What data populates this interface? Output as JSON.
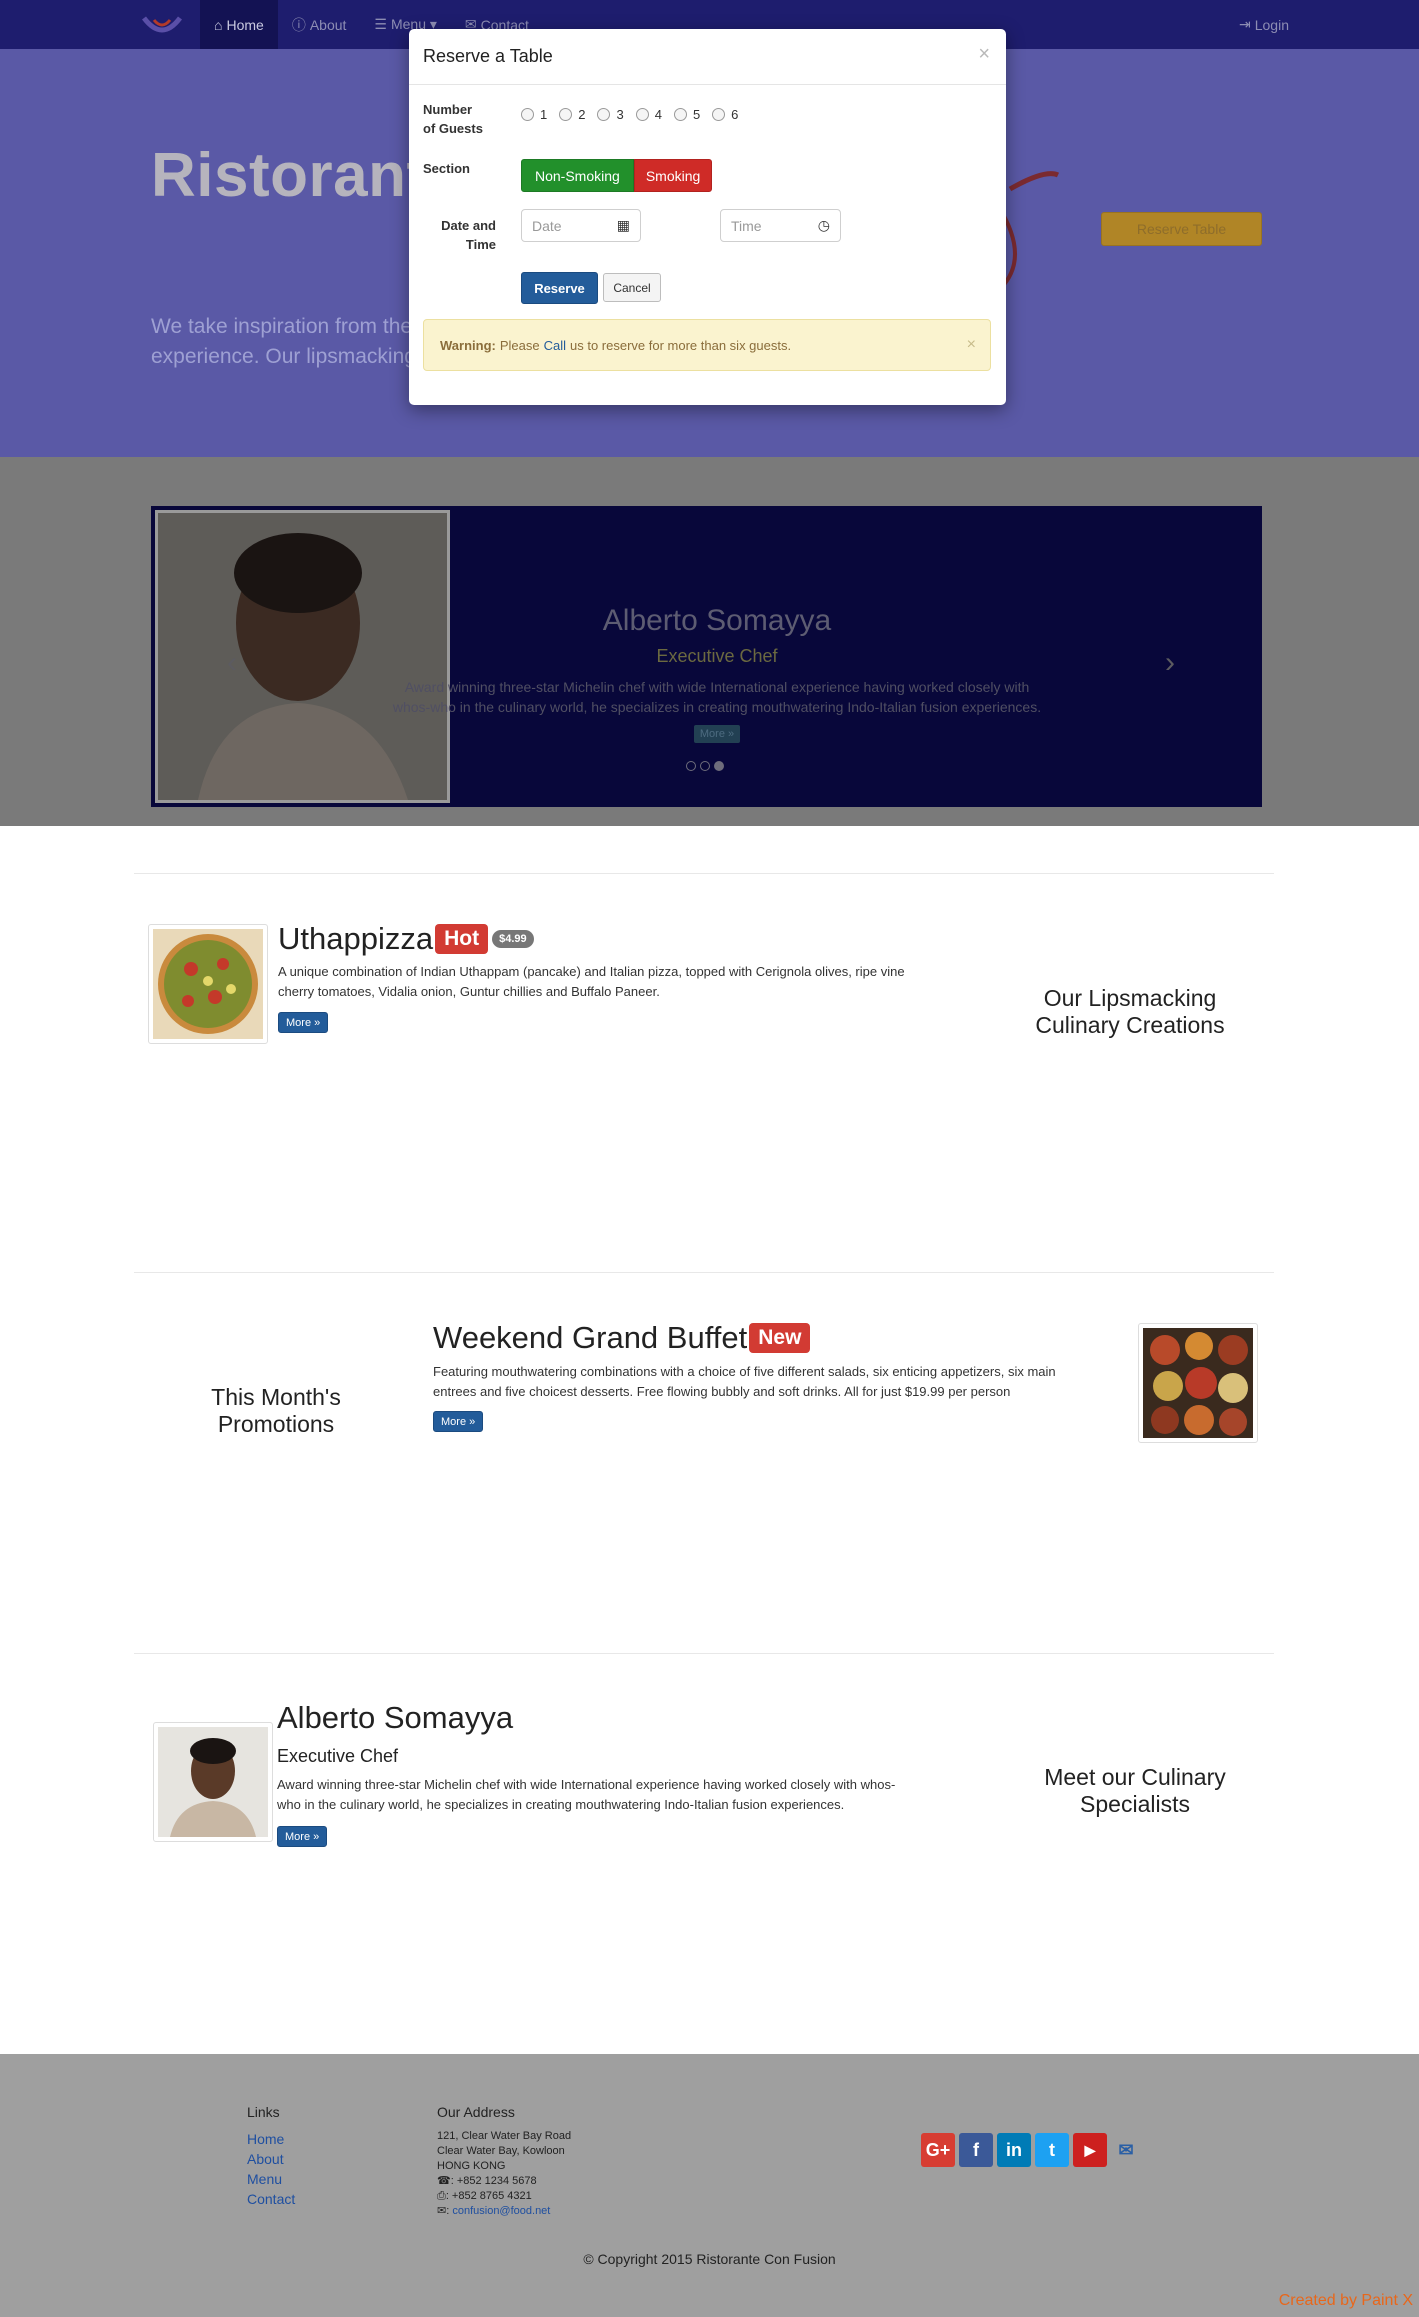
{
  "nav": {
    "items": [
      {
        "label": "Home",
        "icon": "home-icon"
      },
      {
        "label": "About",
        "icon": "info-icon"
      },
      {
        "label": "Menu ▾",
        "icon": "list-icon"
      },
      {
        "label": "Contact",
        "icon": "envelope-icon"
      }
    ],
    "login": "Login"
  },
  "jumbotron": {
    "title": "Ristorant",
    "text_line1": "We take inspiration from the",
    "text_line2": "experience. Our lipsmacking",
    "reserve_button": "Reserve Table"
  },
  "modal": {
    "title": "Reserve a Table",
    "close": "×",
    "guests_label_line1": "Number",
    "guests_label_line2": "of Guests",
    "guest_options": [
      "1",
      "2",
      "3",
      "4",
      "5",
      "6"
    ],
    "section_label": "Section",
    "non_smoking": "Non-Smoking",
    "smoking": "Smoking",
    "datetime_label_line1": "Date and",
    "datetime_label_line2": "Time",
    "date_placeholder": "Date",
    "time_placeholder": "Time",
    "reserve": "Reserve",
    "cancel": "Cancel",
    "warning_strong": "Warning:",
    "warning_pre": "Please",
    "warning_link": "Call",
    "warning_post": "us to reserve for more than six guests.",
    "alert_close": "×"
  },
  "carousel": {
    "name": "Alberto Somayya",
    "role": "Executive Chef",
    "desc_line1": "Award winning three-star Michelin chef with wide International experience having worked closely with",
    "desc_line2": "whos-who in the culinary world, he specializes in creating mouthwatering Indo-Italian fusion experiences.",
    "more": "More »",
    "prev": "‹",
    "next": "›"
  },
  "dish": {
    "title": "Uthappizza",
    "label": "Hot",
    "price": "$4.99",
    "desc_line1": "A unique combination of Indian Uthappam (pancake) and Italian pizza, topped with Cerignola olives, ripe vine",
    "desc_line2": "cherry tomatoes, Vidalia onion, Guntur chillies and Buffalo Paneer.",
    "more": "More »",
    "side_line1": "Our Lipsmacking",
    "side_line2": "Culinary Creations"
  },
  "promo": {
    "title": "Weekend Grand Buffet",
    "label": "New",
    "desc_line1": "Featuring mouthwatering combinations with a choice of five different salads, six enticing appetizers, six main",
    "desc_line2": "entrees and five choicest desserts. Free flowing bubbly and soft drinks. All for just $19.99 per person",
    "more": "More »",
    "side_line1": "This Month's",
    "side_line2": "Promotions"
  },
  "leader": {
    "name": "Alberto Somayya",
    "role": "Executive Chef",
    "desc_line1": "Award winning three-star Michelin chef with wide International experience having worked closely with whos-",
    "desc_line2": "who in the culinary world, he specializes in creating mouthwatering Indo-Italian fusion experiences.",
    "more": "More »",
    "side_line1": "Meet our Culinary",
    "side_line2": "Specialists"
  },
  "footer": {
    "links_heading": "Links",
    "links": [
      "Home",
      "About",
      "Menu",
      "Contact"
    ],
    "address_heading": "Our Address",
    "address_lines": [
      "121, Clear Water Bay Road",
      "Clear Water Bay, Kowloon",
      "HONG KONG"
    ],
    "phone": ": +852 1234 5678",
    "fax": ": +852 8765 4321",
    "email": "confusion@food.net",
    "social": [
      {
        "name": "google-plus-icon",
        "glyph": "G+",
        "color": "#d73d32"
      },
      {
        "name": "facebook-icon",
        "glyph": "f",
        "color": "#3b5998"
      },
      {
        "name": "linkedin-icon",
        "glyph": "in",
        "color": "#007bb6"
      },
      {
        "name": "twitter-icon",
        "glyph": "t",
        "color": "#1da1f2"
      },
      {
        "name": "youtube-icon",
        "glyph": "▶",
        "color": "#cd201f"
      }
    ],
    "copyright": "© Copyright 2015 Ristorante Con Fusion"
  },
  "credit": "Created by Paint X"
}
